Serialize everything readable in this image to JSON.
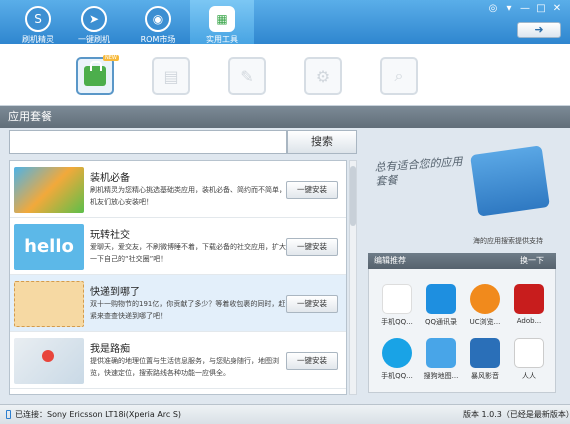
{
  "tabs": [
    {
      "label": "刷机精灵"
    },
    {
      "label": "一键刷机"
    },
    {
      "label": "ROM市场"
    },
    {
      "label": "实用工具"
    }
  ],
  "back_button": "➜",
  "section_title": "应用套餐",
  "search": {
    "placeholder": "",
    "button": "搜索"
  },
  "apps": [
    {
      "title": "装机必备",
      "desc": "刷机精灵为您精心挑选基础类应用，装机必备、简约而不简单，机友们放心安装吧！",
      "install": "一键安装"
    },
    {
      "title": "玩转社交",
      "desc": "爱聊天，爱交友，不刷微博睡不着，下载必备的社交应用，扩大一下自己的“社交圈”吧！",
      "install": "一键安装"
    },
    {
      "title": "快递到哪了",
      "desc": "双十一购物节的191亿，你贡献了多少？等着收包裹的同时，赶紧来查查快递到哪了吧！",
      "install": "一键安装"
    },
    {
      "title": "我是路痴",
      "desc": "提供准确的地理位置与生活信息服务，与您贴身随行，地图浏览，快速定位，搜索路线各种功能一应俱全。",
      "install": "一键安装"
    }
  ],
  "promo": {
    "text": "总有适合您的应用套餐",
    "note": "海的应用搜索提供支持"
  },
  "recommend": {
    "title": "编辑推荐",
    "switch": "换一下",
    "apps": [
      "手机QQ...",
      "QQ通讯录",
      "UC浏览...",
      "Adob...",
      "手机QQ...",
      "搜狗地图...",
      "暴风影音",
      "人人"
    ]
  },
  "status": {
    "connected": "已连接：Sony Ericsson LT18i(Xperia Arc S)",
    "version": "版本 1.0.3（已经是最新版本）"
  },
  "colors": {
    "accent": "#2f86cf",
    "header": "#616e79",
    "install_green": "#3aa64a"
  }
}
